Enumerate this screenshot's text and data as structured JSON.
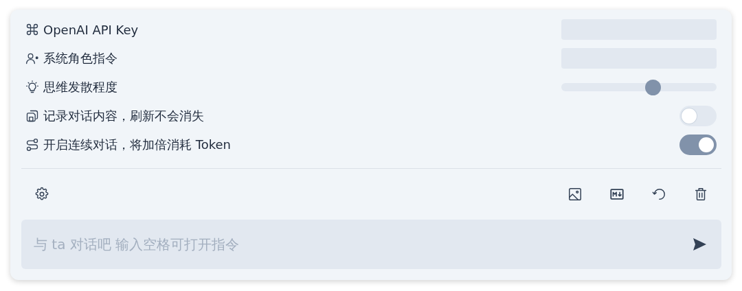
{
  "settings": [
    {
      "kind": "input",
      "label": "OpenAI API Key"
    },
    {
      "kind": "input",
      "label": "系统角色指令"
    },
    {
      "kind": "slider",
      "label": "思维发散程度",
      "level": 0.59
    },
    {
      "kind": "toggle",
      "label": "记录对话内容，刷新不会消失",
      "on": false
    },
    {
      "kind": "toggle",
      "label": "开启连续对话，将加倍消耗 Token",
      "on": true
    }
  ],
  "composer": {
    "placeholder": "与 ta 对话吧 输入空格可打开指令"
  }
}
